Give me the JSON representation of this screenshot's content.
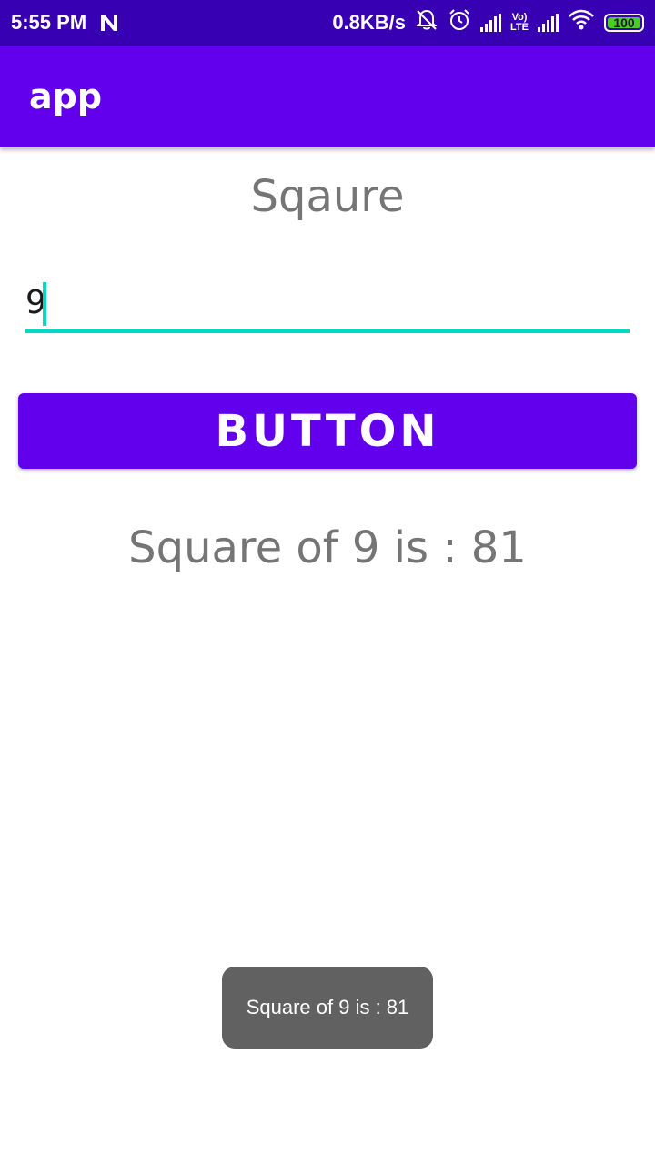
{
  "status_bar": {
    "time": "5:55 PM",
    "network_speed": "0.8KB/s",
    "volte_top": "Vo)",
    "volte_bottom": "LTE",
    "battery": "100",
    "icons": [
      "notification-n-icon",
      "mute-bell-icon",
      "alarm-icon",
      "signal-icon",
      "volte-icon",
      "signal-icon",
      "wifi-icon",
      "battery-icon"
    ],
    "battery_color": "#4ccc2a",
    "background": "#3700b3"
  },
  "app_bar": {
    "title": "app",
    "background": "#6200ee"
  },
  "main": {
    "heading": "Sqaure",
    "input_value": "9",
    "button_label": "BUTTON",
    "result": "Square of 9 is : 81",
    "accent": "#03dac5",
    "primary": "#6200ee"
  },
  "toast": {
    "message": "Square of 9 is : 81"
  }
}
